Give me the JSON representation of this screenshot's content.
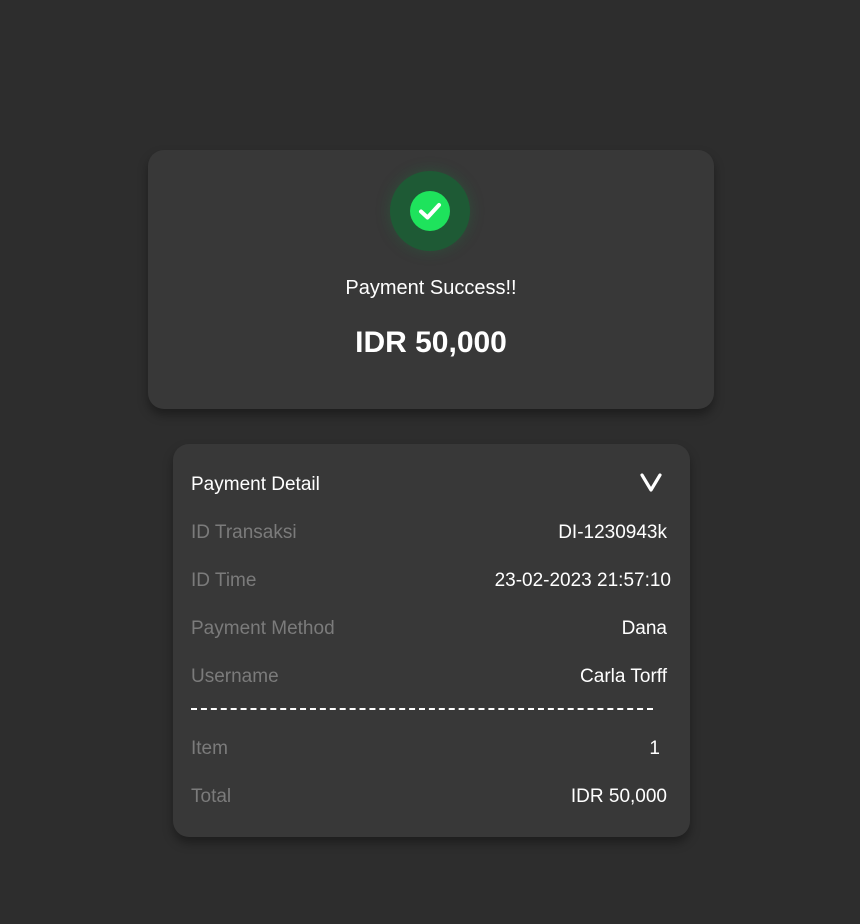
{
  "success": {
    "title": "Payment Success!!",
    "amount": "IDR 50,000",
    "icon": "check-circle-icon",
    "accent_color": "#1ee35c"
  },
  "detail": {
    "title": "Payment Detail",
    "toggle_icon": "chevron-down-icon",
    "rows": [
      {
        "label": "ID Transaksi",
        "value": "DI-1230943k"
      },
      {
        "label": "ID Time",
        "value": "23-02-2023 21:57:10"
      },
      {
        "label": "Payment Method",
        "value": "Dana"
      },
      {
        "label": "Username",
        "value": "Carla Torff"
      }
    ],
    "summary": [
      {
        "label": "Item",
        "value": "1"
      },
      {
        "label": "Total",
        "value": "IDR 50,000"
      }
    ]
  }
}
